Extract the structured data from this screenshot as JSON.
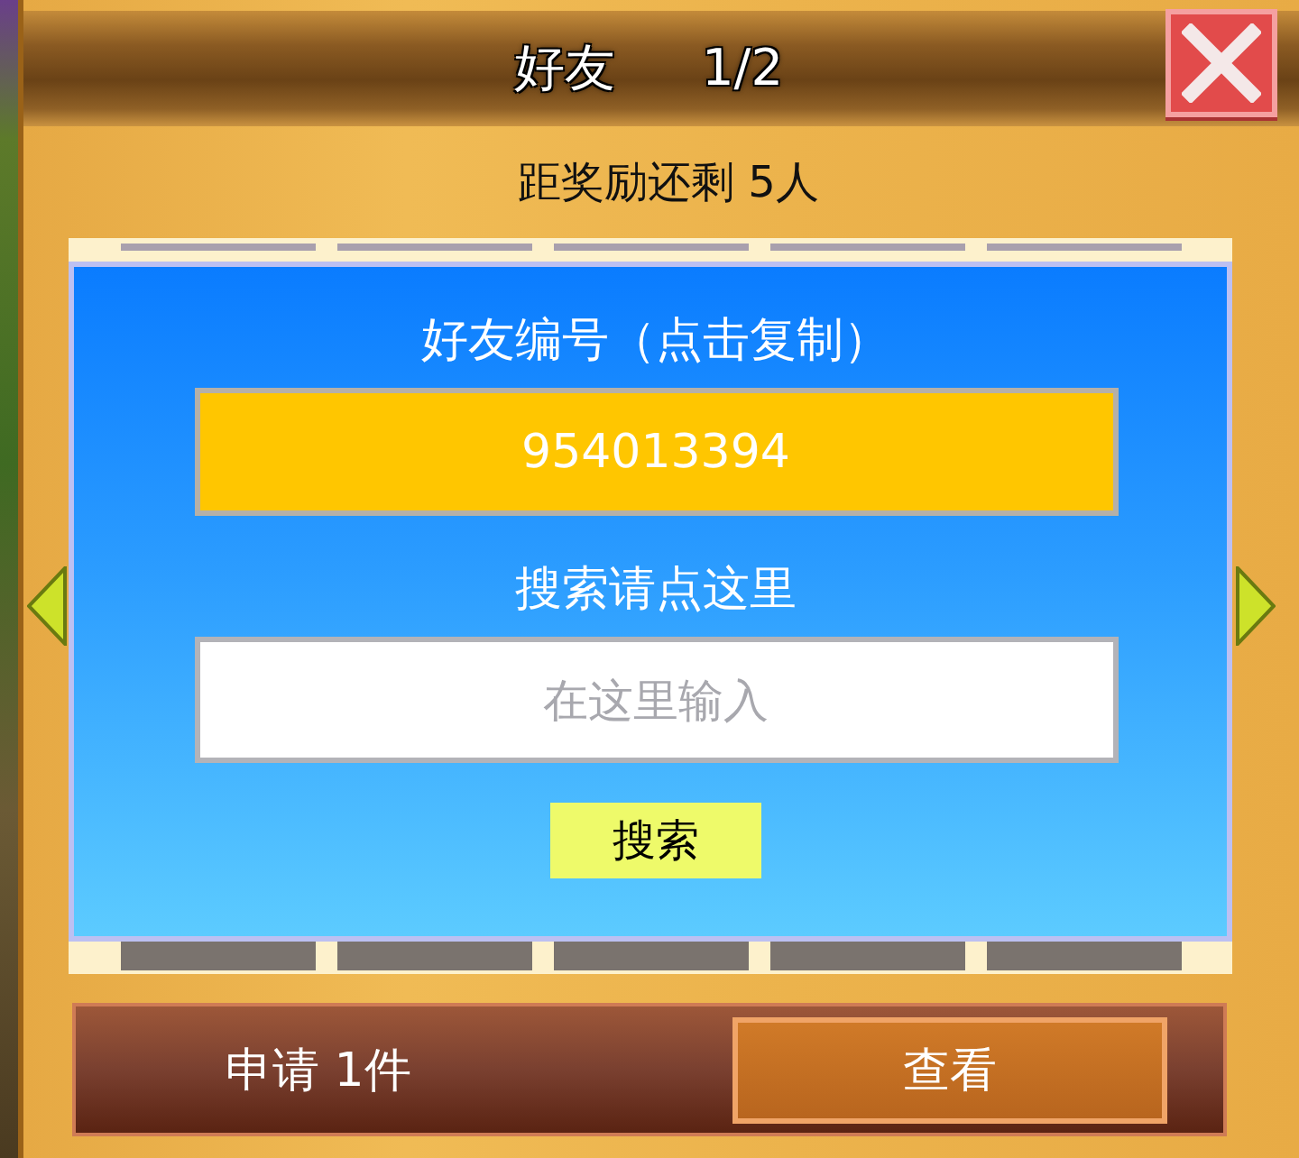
{
  "header": {
    "title": "好友",
    "page": "1/2"
  },
  "subtitle": "距奖励还剩 5人",
  "friend_id": {
    "label": "好友编号（点击复制）",
    "value": "954013394"
  },
  "search": {
    "label": "搜索请点这里",
    "placeholder": "在这里输入",
    "button": "搜索"
  },
  "requests": {
    "text": "申请 1件",
    "button": "查看"
  }
}
